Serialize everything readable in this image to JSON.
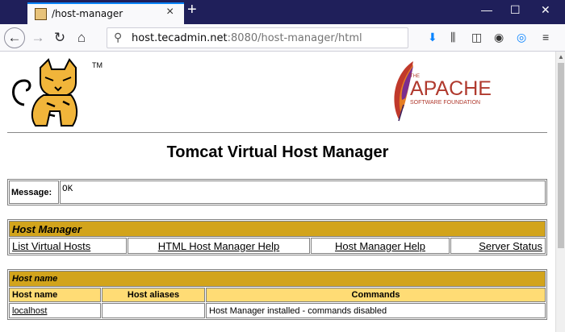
{
  "browser": {
    "tab_title": "/host-manager",
    "url_host": "host.tecadmin.net",
    "url_rest": ":8080/host-manager/html"
  },
  "page": {
    "title": "Tomcat Virtual Host Manager",
    "logos": {
      "tomcat_tm": "TM",
      "apache_the": "THE",
      "apache_name": "APACHE",
      "apache_sub": "SOFTWARE FOUNDATION"
    },
    "message": {
      "label": "Message:",
      "value": "OK"
    },
    "host_manager": {
      "heading": "Host Manager",
      "links": [
        "List Virtual Hosts",
        "HTML Host Manager Help",
        "Host Manager Help",
        "Server Status"
      ]
    },
    "host_name": {
      "heading": "Host name",
      "columns": [
        "Host name",
        "Host aliases",
        "Commands"
      ],
      "rows": [
        {
          "name": "localhost",
          "aliases": "",
          "commands": "Host Manager installed - commands disabled"
        }
      ]
    }
  },
  "colors": {
    "section_header": "#d2a41c",
    "column_header": "#ffdc75",
    "titlebar": "#1f1f5a",
    "accent": "#0a84ff"
  }
}
